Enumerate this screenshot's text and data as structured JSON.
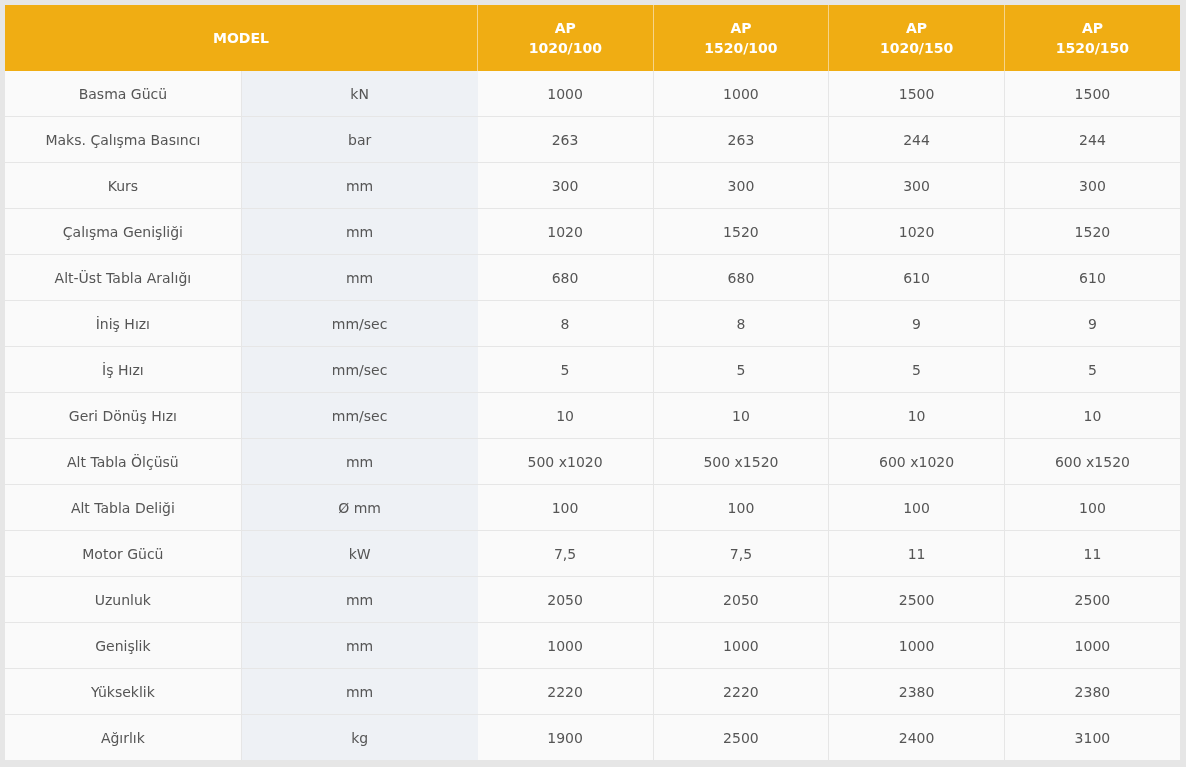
{
  "table": {
    "header": {
      "label": "MODEL",
      "models": [
        {
          "lines": [
            "AP",
            "1020/100"
          ]
        },
        {
          "lines": [
            "AP",
            "1520/100"
          ]
        },
        {
          "lines": [
            "AP",
            "1020/150"
          ]
        },
        {
          "lines": [
            "AP",
            "1520/150"
          ]
        }
      ]
    },
    "rows": [
      {
        "label": "Basma Gücü",
        "unit": "kN",
        "values": [
          "1000",
          "1000",
          "1500",
          "1500"
        ]
      },
      {
        "label": "Maks. Çalışma Basıncı",
        "unit": "bar",
        "values": [
          "263",
          "263",
          "244",
          "244"
        ]
      },
      {
        "label": "Kurs",
        "unit": "mm",
        "values": [
          "300",
          "300",
          "300",
          "300"
        ]
      },
      {
        "label": "Çalışma Genişliği",
        "unit": "mm",
        "values": [
          "1020",
          "1520",
          "1020",
          "1520"
        ]
      },
      {
        "label": "Alt-Üst Tabla Aralığı",
        "unit": "mm",
        "values": [
          "680",
          "680",
          "610",
          "610"
        ]
      },
      {
        "label": "İniş Hızı",
        "unit": "mm/sec",
        "values": [
          "8",
          "8",
          "9",
          "9"
        ]
      },
      {
        "label": "İş Hızı",
        "unit": "mm/sec",
        "values": [
          "5",
          "5",
          "5",
          "5"
        ]
      },
      {
        "label": "Geri Dönüş Hızı",
        "unit": "mm/sec",
        "values": [
          "10",
          "10",
          "10",
          "10"
        ]
      },
      {
        "label": "Alt Tabla Ölçüsü",
        "unit": "mm",
        "values": [
          "500 x1020",
          "500 x1520",
          "600 x1020",
          "600 x1520"
        ]
      },
      {
        "label": "Alt Tabla Deliği",
        "unit": "Ø mm",
        "values": [
          "100",
          "100",
          "100",
          "100"
        ]
      },
      {
        "label": "Motor Gücü",
        "unit": "kW",
        "values": [
          "7,5",
          "7,5",
          "11",
          "11"
        ]
      },
      {
        "label": "Uzunluk",
        "unit": "mm",
        "values": [
          "2050",
          "2050",
          "2500",
          "2500"
        ]
      },
      {
        "label": "Genişlik",
        "unit": "mm",
        "values": [
          "1000",
          "1000",
          "1000",
          "1000"
        ]
      },
      {
        "label": "Yükseklik",
        "unit": "mm",
        "values": [
          "2220",
          "2220",
          "2380",
          "2380"
        ]
      },
      {
        "label": "Ağırlık",
        "unit": "kg",
        "values": [
          "1900",
          "2500",
          "2400",
          "3100"
        ]
      }
    ]
  }
}
